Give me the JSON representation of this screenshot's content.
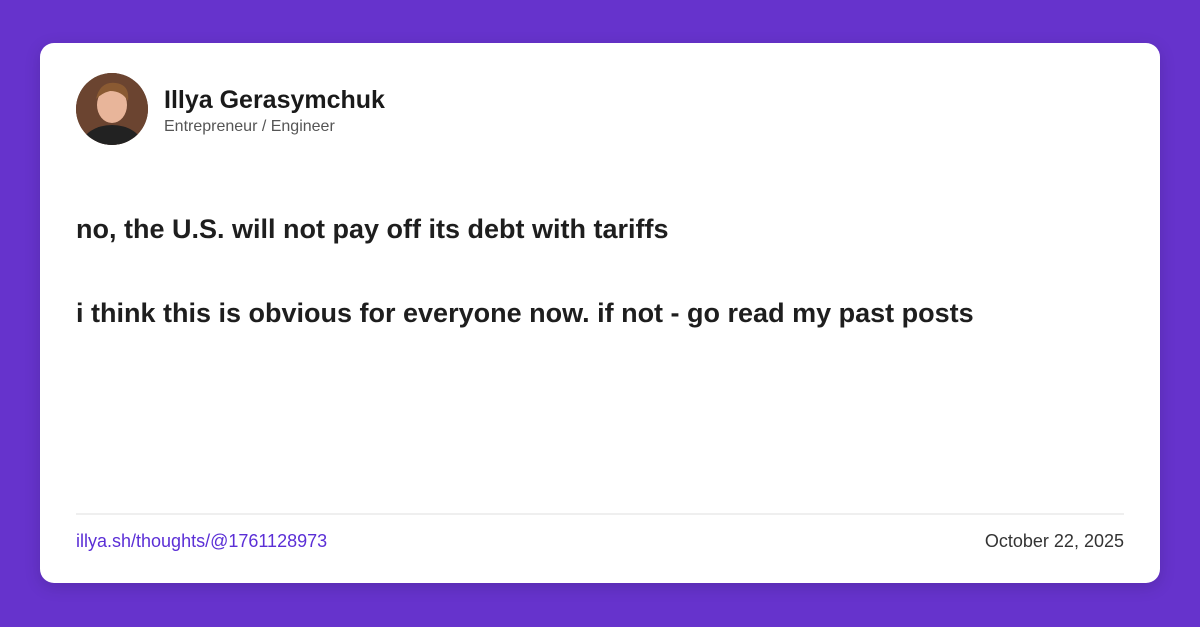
{
  "author": {
    "name": "Illya Gerasymchuk",
    "role": "Entrepreneur / Engineer"
  },
  "post": {
    "lines": [
      "no, the U.S. will not pay off its debt with tariffs",
      "i think this is obvious for everyone now. if not - go read my past posts"
    ]
  },
  "footer": {
    "link": "illya.sh/thoughts/@1761128973",
    "date": "October 22, 2025"
  },
  "colors": {
    "background": "#6633cc",
    "link": "#5b2fd6"
  }
}
